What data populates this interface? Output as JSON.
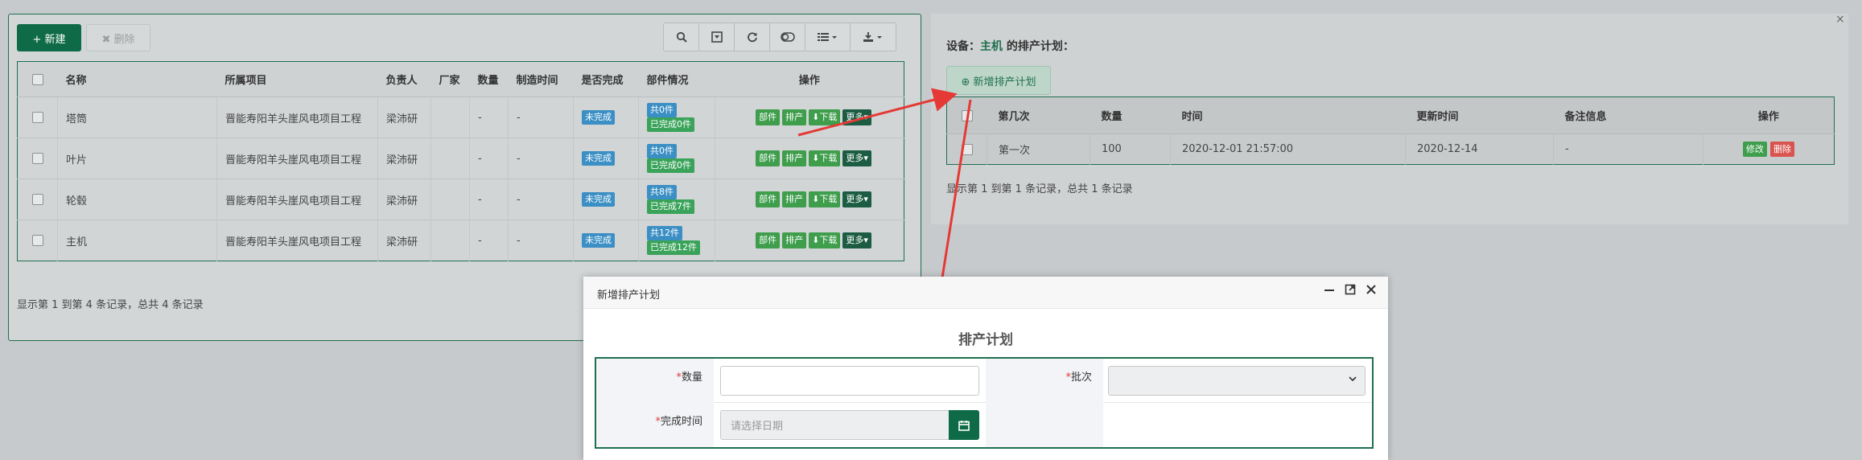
{
  "left": {
    "new_label": "+ 新建",
    "delete_label": "✖ 删除",
    "toolbar": [
      "search-icon",
      "collapse-icon",
      "refresh-icon",
      "toggle-icon",
      "columns-icon",
      "export-icon"
    ],
    "columns": [
      "名称",
      "所属项目",
      "负责人",
      "厂家",
      "数量",
      "制造时间",
      "是否完成",
      "部件情况",
      "操作"
    ],
    "rows": [
      {
        "name": "塔筒",
        "project": "晋能寿阳羊头崖风电项目工程",
        "owner": "梁沛研",
        "vendor": "",
        "qty": "-",
        "date": "-",
        "status": "未完成",
        "parts_total": "共0件",
        "parts_done": "已完成0件"
      },
      {
        "name": "叶片",
        "project": "晋能寿阳羊头崖风电项目工程",
        "owner": "梁沛研",
        "vendor": "",
        "qty": "-",
        "date": "-",
        "status": "未完成",
        "parts_total": "共0件",
        "parts_done": "已完成0件"
      },
      {
        "name": "轮毂",
        "project": "晋能寿阳羊头崖风电项目工程",
        "owner": "梁沛研",
        "vendor": "",
        "qty": "-",
        "date": "-",
        "status": "未完成",
        "parts_total": "共8件",
        "parts_done": "已完成7件"
      },
      {
        "name": "主机",
        "project": "晋能寿阳羊头崖风电项目工程",
        "owner": "梁沛研",
        "vendor": "",
        "qty": "-",
        "date": "-",
        "status": "未完成",
        "parts_total": "共12件",
        "parts_done": "已完成12件"
      }
    ],
    "ops": {
      "parts": "部件",
      "schedule": "排产",
      "download": "⬇下载",
      "more": "更多▾"
    },
    "footer": "显示第 1 到第 4 条记录，总共 4 条记录"
  },
  "right": {
    "title_prefix": "设备：",
    "device": "主机",
    "title_suffix": " 的排产计划：",
    "add_label": "⊕ 新增排产计划",
    "columns": [
      "第几次",
      "数量",
      "时间",
      "更新时间",
      "备注信息",
      "操作"
    ],
    "rows": [
      {
        "order": "第一次",
        "qty": "100",
        "time": "2020-12-01 21:57:00",
        "updated": "2020-12-14",
        "note": "-"
      }
    ],
    "edit": "修改",
    "remove": "删除",
    "footer": "显示第 1 到第 1 条记录，总共 1 条记录",
    "close": "×"
  },
  "modal": {
    "title": "新增排产计划",
    "heading": "排产计划",
    "qty_label": "数量",
    "batch_label": "批次",
    "date_label": "完成时间",
    "date_placeholder": "请选择日期",
    "required_mark": "*"
  },
  "colors": {
    "accent": "#0f6b47",
    "arrow": "#e53935"
  }
}
